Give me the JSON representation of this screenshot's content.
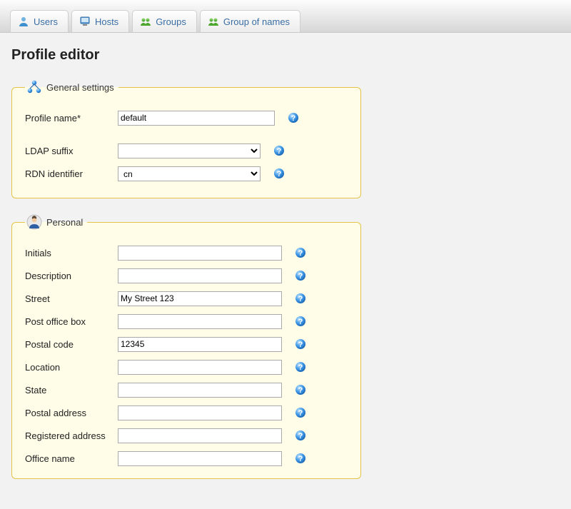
{
  "tabs": {
    "users": "Users",
    "hosts": "Hosts",
    "groups": "Groups",
    "group_of_names": "Group of names"
  },
  "page_title": "Profile editor",
  "general": {
    "legend": "General settings",
    "profile_name_label": "Profile name*",
    "profile_name_value": "default",
    "ldap_suffix_label": "LDAP suffix",
    "ldap_suffix_value": "",
    "rdn_identifier_label": "RDN identifier",
    "rdn_identifier_value": "cn"
  },
  "personal": {
    "legend": "Personal",
    "fields": {
      "initials": {
        "label": "Initials",
        "value": ""
      },
      "description": {
        "label": "Description",
        "value": ""
      },
      "street": {
        "label": "Street",
        "value": "My Street 123"
      },
      "pobox": {
        "label": "Post office box",
        "value": ""
      },
      "postal_code": {
        "label": "Postal code",
        "value": "12345"
      },
      "location": {
        "label": "Location",
        "value": ""
      },
      "state": {
        "label": "State",
        "value": ""
      },
      "postal_address": {
        "label": "Postal address",
        "value": ""
      },
      "registered_address": {
        "label": "Registered address",
        "value": ""
      },
      "office_name": {
        "label": "Office name",
        "value": ""
      }
    }
  }
}
